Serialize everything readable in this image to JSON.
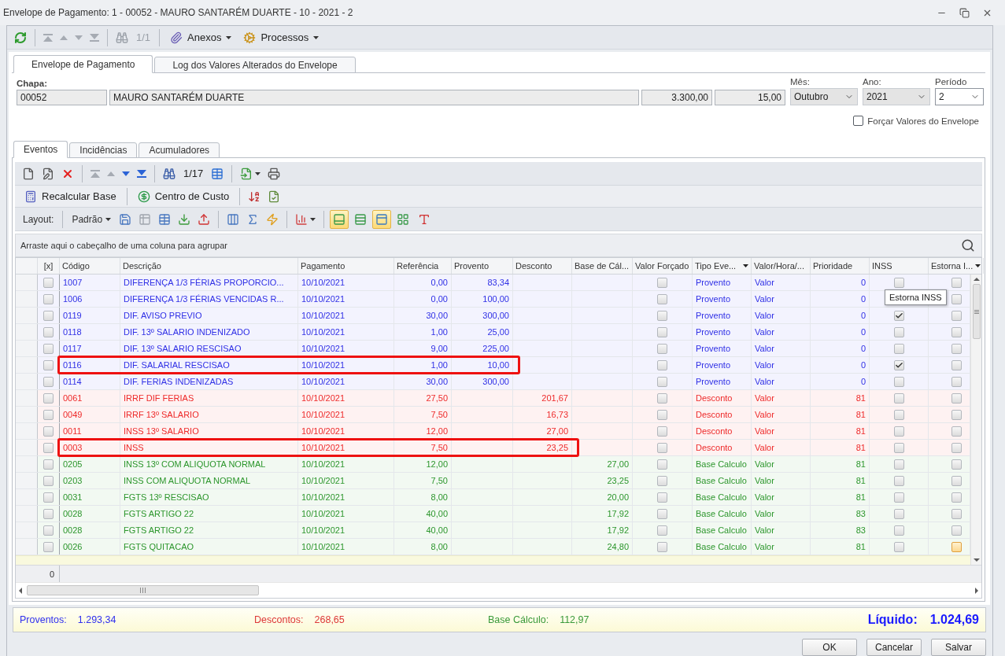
{
  "window": {
    "title": "Envelope de Pagamento: 1 - 00052 - MAURO SANTARÉM DUARTE - 10 - 2021 - 2"
  },
  "main_toolbar": {
    "navigation_enabled": false,
    "counter": "1/1",
    "menus": [
      {
        "label": "Anexos"
      },
      {
        "label": "Processos"
      }
    ]
  },
  "tabs": [
    {
      "label": "Envelope de Pagamento",
      "selected": true
    },
    {
      "label": "Log dos Valores Alterados do Envelope",
      "selected": false
    }
  ],
  "employee": {
    "label": "Chapa:",
    "fields": [
      {
        "value": "00052"
      },
      {
        "value": "MAURO SANTARÉM DUARTE"
      },
      {
        "value": "3.300,00"
      },
      {
        "value": "15,00"
      }
    ]
  },
  "period": [
    {
      "label": "Mês:",
      "value": "Outubro",
      "disabled": true
    },
    {
      "label": "Ano:",
      "value": "2021",
      "disabled": true
    },
    {
      "label": "Período",
      "value": "2",
      "disabled": false
    }
  ],
  "force_values": {
    "label": "Forçar Valores do Envelope",
    "checked": false
  },
  "event_tabs": [
    {
      "label": "Eventos",
      "selected": true
    },
    {
      "label": "Incidências",
      "selected": false
    },
    {
      "label": "Acumuladores",
      "selected": false
    }
  ],
  "record_toolbar": {
    "counter": "1/17",
    "nav": [
      {
        "disabled": true
      },
      {
        "disabled": true
      },
      {
        "disabled": false
      },
      {
        "disabled": false
      }
    ]
  },
  "actions": [
    {
      "label": "Recalcular Base"
    },
    {
      "label": "Centro de Custo"
    }
  ],
  "layout_bar": {
    "label": "Layout:",
    "preset": "Padrão",
    "toggles": [
      {
        "selected": true
      },
      {
        "selected": false
      },
      {
        "selected": true
      },
      {
        "selected": false
      },
      {
        "selected": false
      }
    ]
  },
  "group_panel": {
    "hint": "Arraste aqui o cabeçalho de uma coluna para agrupar"
  },
  "table": {
    "columns": [
      {
        "label": "[x]",
        "filter": false
      },
      {
        "label": "Código",
        "filter": false
      },
      {
        "label": "Descrição",
        "filter": false
      },
      {
        "label": "Pagamento",
        "filter": false
      },
      {
        "label": "Referência",
        "filter": false
      },
      {
        "label": "Provento",
        "filter": false
      },
      {
        "label": "Desconto",
        "filter": false
      },
      {
        "label": "Base de Cál...",
        "filter": false
      },
      {
        "label": "Valor Forçado",
        "filter": false
      },
      {
        "label": "Tipo Eve...",
        "filter": true
      },
      {
        "label": "Valor/Hora/...",
        "filter": false
      },
      {
        "label": "Prioridade",
        "filter": false
      },
      {
        "label": "INSS",
        "filter": false
      },
      {
        "label": "Estorna I...",
        "filter": true
      }
    ],
    "rows": [
      {
        "color": "#2f2fe6",
        "marked": false,
        "code": "1007",
        "description": "DIFERENÇA 1/3 FÉRIAS PROPORCIO...",
        "payment": "10/10/2021",
        "reference": "0,00",
        "provento": "83,34",
        "forced": false,
        "type": "Provento",
        "value_mode": "Valor",
        "priority": "0",
        "inss": false,
        "estorna": false,
        "estorna_focused": false,
        "highlight": false
      },
      {
        "color": "#2f2fe6",
        "marked": false,
        "code": "1006",
        "description": "DIFERENÇA 1/3 FÉRIAS VENCIDAS R...",
        "payment": "10/10/2021",
        "reference": "0,00",
        "provento": "100,00",
        "forced": false,
        "type": "Provento",
        "value_mode": "Valor",
        "priority": "0",
        "estorna": false,
        "estorna_focused": false,
        "highlight": false
      },
      {
        "color": "#2f2fe6",
        "marked": false,
        "code": "0119",
        "description": "DIF. AVISO PREVIO",
        "payment": "10/10/2021",
        "reference": "30,00",
        "provento": "300,00",
        "forced": false,
        "type": "Provento",
        "value_mode": "Valor",
        "priority": "0",
        "inss": true,
        "estorna": false,
        "estorna_focused": false,
        "highlight": false
      },
      {
        "color": "#2f2fe6",
        "marked": false,
        "code": "0118",
        "description": "DIF. 13º SALARIO INDENIZADO",
        "payment": "10/10/2021",
        "reference": "1,00",
        "provento": "25,00",
        "forced": false,
        "type": "Provento",
        "value_mode": "Valor",
        "priority": "0",
        "inss": false,
        "estorna": false,
        "estorna_focused": false,
        "highlight": false
      },
      {
        "color": "#2f2fe6",
        "marked": false,
        "code": "0117",
        "description": "DIF. 13º SALARIO RESCISAO",
        "payment": "10/10/2021",
        "reference": "9,00",
        "provento": "225,00",
        "forced": false,
        "type": "Provento",
        "value_mode": "Valor",
        "priority": "0",
        "inss": false,
        "estorna": false,
        "estorna_focused": false,
        "highlight": false
      },
      {
        "color": "#2f2fe6",
        "marked": false,
        "code": "0116",
        "description": "DIF. SALARIAL RESCISAO",
        "payment": "10/10/2021",
        "reference": "1,00",
        "provento": "10,00",
        "forced": false,
        "type": "Provento",
        "value_mode": "Valor",
        "priority": "0",
        "inss": true,
        "estorna": false,
        "estorna_focused": false,
        "highlight": true
      },
      {
        "color": "#2f2fe6",
        "marked": false,
        "code": "0114",
        "description": "DIF. FERIAS INDENIZADAS",
        "payment": "10/10/2021",
        "reference": "30,00",
        "provento": "300,00",
        "forced": false,
        "type": "Provento",
        "value_mode": "Valor",
        "priority": "0",
        "inss": false,
        "estorna": false,
        "estorna_focused": false,
        "highlight": false
      },
      {
        "color": "#ee2a2a",
        "marked": false,
        "code": "0061",
        "description": "IRRF DIF FERIAS",
        "payment": "10/10/2021",
        "reference": "27,50",
        "desconto": "201,67",
        "forced": false,
        "type": "Desconto",
        "value_mode": "Valor",
        "priority": "81",
        "inss": false,
        "estorna": false,
        "estorna_focused": false,
        "highlight": false
      },
      {
        "color": "#ee2a2a",
        "marked": false,
        "code": "0049",
        "description": "IRRF 13º SALARIO",
        "payment": "10/10/2021",
        "reference": "7,50",
        "desconto": "16,73",
        "forced": false,
        "type": "Desconto",
        "value_mode": "Valor",
        "priority": "81",
        "inss": false,
        "estorna": false,
        "estorna_focused": false,
        "highlight": false
      },
      {
        "color": "#ee2a2a",
        "marked": false,
        "code": "0011",
        "description": "INSS 13º SALARIO",
        "payment": "10/10/2021",
        "reference": "12,00",
        "desconto": "27,00",
        "forced": false,
        "type": "Desconto",
        "value_mode": "Valor",
        "priority": "81",
        "inss": false,
        "estorna": false,
        "estorna_focused": false,
        "highlight": false
      },
      {
        "color": "#ee2a2a",
        "marked": false,
        "code": "0003",
        "description": "INSS",
        "payment": "10/10/2021",
        "reference": "7,50",
        "desconto": "23,25",
        "forced": false,
        "type": "Desconto",
        "value_mode": "Valor",
        "priority": "81",
        "inss": false,
        "estorna": false,
        "estorna_focused": false,
        "highlight": true
      },
      {
        "color": "#2c962c",
        "marked": false,
        "code": "0205",
        "description": "INSS 13º COM ALIQUOTA NORMAL",
        "payment": "10/10/2021",
        "reference": "12,00",
        "base": "27,00",
        "forced": false,
        "type": "Base Calculo",
        "value_mode": "Valor",
        "priority": "81",
        "inss": false,
        "estorna": false,
        "estorna_focused": false,
        "highlight": false
      },
      {
        "color": "#2c962c",
        "marked": false,
        "code": "0203",
        "description": "INSS COM ALIQUOTA NORMAL",
        "payment": "10/10/2021",
        "reference": "7,50",
        "base": "23,25",
        "forced": false,
        "type": "Base Calculo",
        "value_mode": "Valor",
        "priority": "81",
        "inss": false,
        "estorna": false,
        "estorna_focused": false,
        "highlight": false
      },
      {
        "color": "#2c962c",
        "marked": false,
        "code": "0031",
        "description": "FGTS 13º RESCISAO",
        "payment": "10/10/2021",
        "reference": "8,00",
        "base": "20,00",
        "forced": false,
        "type": "Base Calculo",
        "value_mode": "Valor",
        "priority": "81",
        "inss": false,
        "estorna": false,
        "estorna_focused": false,
        "highlight": false
      },
      {
        "color": "#2c962c",
        "marked": false,
        "code": "0028",
        "description": "FGTS ARTIGO 22",
        "payment": "10/10/2021",
        "reference": "40,00",
        "base": "17,92",
        "forced": false,
        "type": "Base Calculo",
        "value_mode": "Valor",
        "priority": "83",
        "inss": false,
        "estorna": false,
        "estorna_focused": false,
        "highlight": false
      },
      {
        "color": "#2c962c",
        "marked": false,
        "code": "0028",
        "description": "FGTS ARTIGO 22",
        "payment": "10/10/2021",
        "reference": "40,00",
        "base": "17,92",
        "forced": false,
        "type": "Base Calculo",
        "value_mode": "Valor",
        "priority": "83",
        "inss": false,
        "estorna": false,
        "estorna_focused": false,
        "highlight": false
      },
      {
        "color": "#2c962c",
        "marked": false,
        "code": "0026",
        "description": "FGTS QUITACAO",
        "payment": "10/10/2021",
        "reference": "8,00",
        "base": "24,80",
        "forced": false,
        "type": "Base Calculo",
        "value_mode": "Valor",
        "priority": "81",
        "inss": false,
        "estorna": false,
        "estorna_focused": true,
        "highlight": false
      }
    ],
    "tooltip": "Estorna INSS",
    "footer_count": "0"
  },
  "totals": [
    {
      "label": "Proventos:",
      "value": "1.293,34",
      "color": "#3030ee"
    },
    {
      "label": "Descontos:",
      "value": "268,65",
      "color": "#dd3838"
    },
    {
      "label": "Base Cálculo:",
      "value": "112,97",
      "color": "#3a9a3a"
    }
  ],
  "net": {
    "label": "Líquido:",
    "value": "1.024,69"
  },
  "buttons": [
    "OK",
    "Cancelar",
    "Salvar"
  ]
}
